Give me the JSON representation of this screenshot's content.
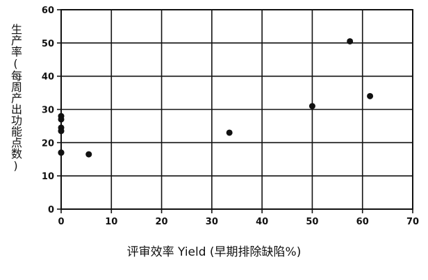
{
  "chart_data": {
    "type": "scatter",
    "title": "",
    "xlabel": "评审效率 Yield (早期排除缺陷%)",
    "ylabel": "生产率(每周产出功能点数)",
    "xlim": [
      0,
      70
    ],
    "ylim": [
      0,
      60
    ],
    "xticks": [
      "0",
      "10",
      "20",
      "30",
      "40",
      "50",
      "60",
      "70"
    ],
    "yticks": [
      "0",
      "10",
      "20",
      "30",
      "40",
      "50",
      "60"
    ],
    "grid": true,
    "marker_color": "#111111",
    "series": [
      {
        "x": [
          0,
          0,
          0,
          0,
          0,
          0,
          5.5,
          33.5,
          50,
          57.5,
          61.5
        ],
        "y": [
          28,
          27,
          24.5,
          23.5,
          17,
          17,
          16.5,
          23,
          31,
          50.5,
          34
        ]
      }
    ]
  }
}
